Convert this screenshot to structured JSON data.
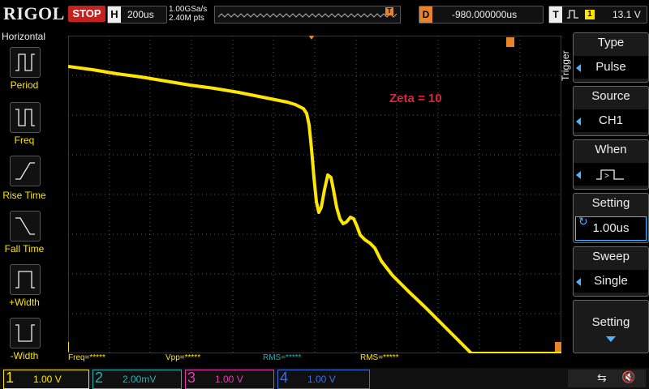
{
  "top": {
    "logo": "RIGOL",
    "run_state": "STOP",
    "horizontal": {
      "label": "H",
      "value": "200us"
    },
    "sample_rate": "1.00GSa/s",
    "memory_points": "2.40M pts",
    "delay": {
      "label": "D",
      "value": "-980.000000us"
    },
    "trigger": {
      "label": "T",
      "edge_icon": "pulse-icon",
      "channel": "1",
      "level": "13.1 V"
    }
  },
  "left_panel": {
    "title": "Horizontal",
    "items": [
      {
        "label": "Period",
        "icon": "period-icon"
      },
      {
        "label": "Freq",
        "icon": "freq-icon"
      },
      {
        "label": "Rise Time",
        "icon": "rise-time-icon"
      },
      {
        "label": "Fall Time",
        "icon": "fall-time-icon"
      },
      {
        "label": "+Width",
        "icon": "pos-width-icon"
      },
      {
        "label": "-Width",
        "icon": "neg-width-icon"
      }
    ]
  },
  "plot": {
    "annotation": "Zeta = 10",
    "trace_color": "#ffe600",
    "grid_color": "#5a5a5a"
  },
  "stats": [
    "Freq=*****",
    "Vpp=*****",
    "RMS=*****",
    "RMS=*****"
  ],
  "right_menu": {
    "side_label": "Trigger",
    "items": [
      {
        "title": "Type",
        "value": "Pulse"
      },
      {
        "title": "Source",
        "value": "CH1"
      },
      {
        "title": "When",
        "value": ""
      },
      {
        "title": "Setting",
        "value": "1.00us"
      },
      {
        "title": "Sweep",
        "value": "Single"
      },
      {
        "title": "Setting",
        "value": ""
      }
    ]
  },
  "bottom": {
    "channels": [
      {
        "num": "1",
        "value": "1.00 V",
        "color": "#ffe600"
      },
      {
        "num": "2",
        "value": "2.00mV",
        "color": "#27b0b0"
      },
      {
        "num": "3",
        "value": "1.00 V",
        "color": "#e33cb0"
      },
      {
        "num": "4",
        "value": "1.00 V",
        "color": "#3c6fe3"
      }
    ]
  }
}
